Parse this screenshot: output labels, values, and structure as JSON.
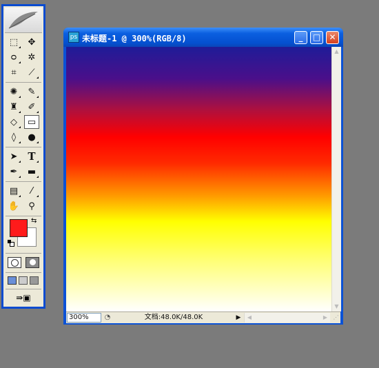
{
  "window": {
    "title": "未标题-1 @ 300%(RGB/8)",
    "minimize_glyph": "_",
    "maximize_glyph": "□",
    "close_glyph": "✕"
  },
  "status": {
    "zoom": "300%",
    "doc_info": "文档:48.0K/48.0K",
    "menu_glyph": "◔",
    "arrow_glyph": "▶"
  },
  "toolbox": {
    "tools": [
      {
        "name": "rectangular-marquee-tool",
        "glyph": "⬚"
      },
      {
        "name": "move-tool",
        "glyph": "✥"
      },
      {
        "name": "lasso-tool",
        "glyph": "ᴑ"
      },
      {
        "name": "magic-wand-tool",
        "glyph": "✲"
      },
      {
        "name": "crop-tool",
        "glyph": "⌗"
      },
      {
        "name": "slice-tool",
        "glyph": "⟋"
      },
      {
        "name": "healing-brush-tool",
        "glyph": "✺"
      },
      {
        "name": "brush-tool",
        "glyph": "✎"
      },
      {
        "name": "clone-stamp-tool",
        "glyph": "♜"
      },
      {
        "name": "history-brush-tool",
        "glyph": "✐"
      },
      {
        "name": "eraser-tool",
        "glyph": "◇"
      },
      {
        "name": "gradient-tool",
        "glyph": "▭"
      },
      {
        "name": "blur-tool",
        "glyph": "◊"
      },
      {
        "name": "dodge-tool",
        "glyph": "●"
      },
      {
        "name": "path-selection-tool",
        "glyph": "➤"
      },
      {
        "name": "type-tool",
        "glyph": "T"
      },
      {
        "name": "pen-tool",
        "glyph": "✒"
      },
      {
        "name": "shape-tool",
        "glyph": "▬"
      },
      {
        "name": "notes-tool",
        "glyph": "▤"
      },
      {
        "name": "eyedropper-tool",
        "glyph": "⁄"
      },
      {
        "name": "hand-tool",
        "glyph": "✋"
      },
      {
        "name": "zoom-tool",
        "glyph": "⚲"
      }
    ],
    "active_tool": "gradient-tool",
    "foreground_color": "#ff1b1b",
    "background_color": "#ffffff"
  },
  "canvas": {
    "gradient_colors": [
      "#1f1c98",
      "#ff0000",
      "#ffff00",
      "#ffffff"
    ]
  }
}
